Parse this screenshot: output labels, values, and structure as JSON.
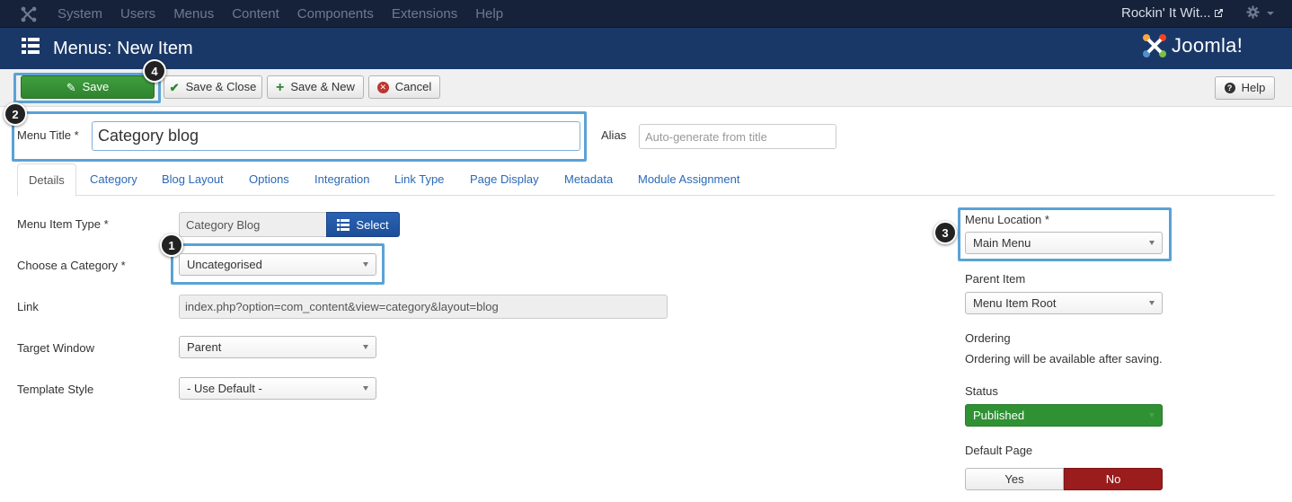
{
  "topnav": {
    "menu": [
      "System",
      "Users",
      "Menus",
      "Content",
      "Components",
      "Extensions",
      "Help"
    ],
    "site_name": "Rockin' It Wit..."
  },
  "header": {
    "title": "Menus: New Item",
    "logo_text": "Joomla!"
  },
  "toolbar": {
    "save": "Save",
    "save_close": "Save & Close",
    "save_new": "Save & New",
    "cancel": "Cancel",
    "help": "Help"
  },
  "form": {
    "menu_title_label": "Menu Title *",
    "menu_title_value": "Category blog",
    "alias_label": "Alias",
    "alias_placeholder": "Auto-generate from title"
  },
  "tabs": [
    "Details",
    "Category",
    "Blog Layout",
    "Options",
    "Integration",
    "Link Type",
    "Page Display",
    "Metadata",
    "Module Assignment"
  ],
  "details": {
    "menu_item_type_label": "Menu Item Type *",
    "menu_item_type_value": "Category Blog",
    "select_button": "Select",
    "category_label": "Choose a Category *",
    "category_value": "Uncategorised",
    "link_label": "Link",
    "link_value": "index.php?option=com_content&view=category&layout=blog",
    "target_label": "Target Window",
    "target_value": "Parent",
    "template_label": "Template Style",
    "template_value": "- Use Default -"
  },
  "sidebar": {
    "menu_location_label": "Menu Location *",
    "menu_location_value": "Main Menu",
    "parent_label": "Parent Item",
    "parent_value": "Menu Item Root",
    "ordering_label": "Ordering",
    "ordering_note": "Ordering will be available after saving.",
    "status_label": "Status",
    "status_value": "Published",
    "default_label": "Default Page",
    "default_yes": "Yes",
    "default_no": "No"
  },
  "annotations": [
    "1",
    "2",
    "3",
    "4"
  ],
  "colors": {
    "navbar": "#152239",
    "header": "#1a3867",
    "save_green": "#2f842f",
    "highlight": "#5aa2d6",
    "link_blue": "#2a69b8",
    "no_red": "#9a1c1c"
  }
}
